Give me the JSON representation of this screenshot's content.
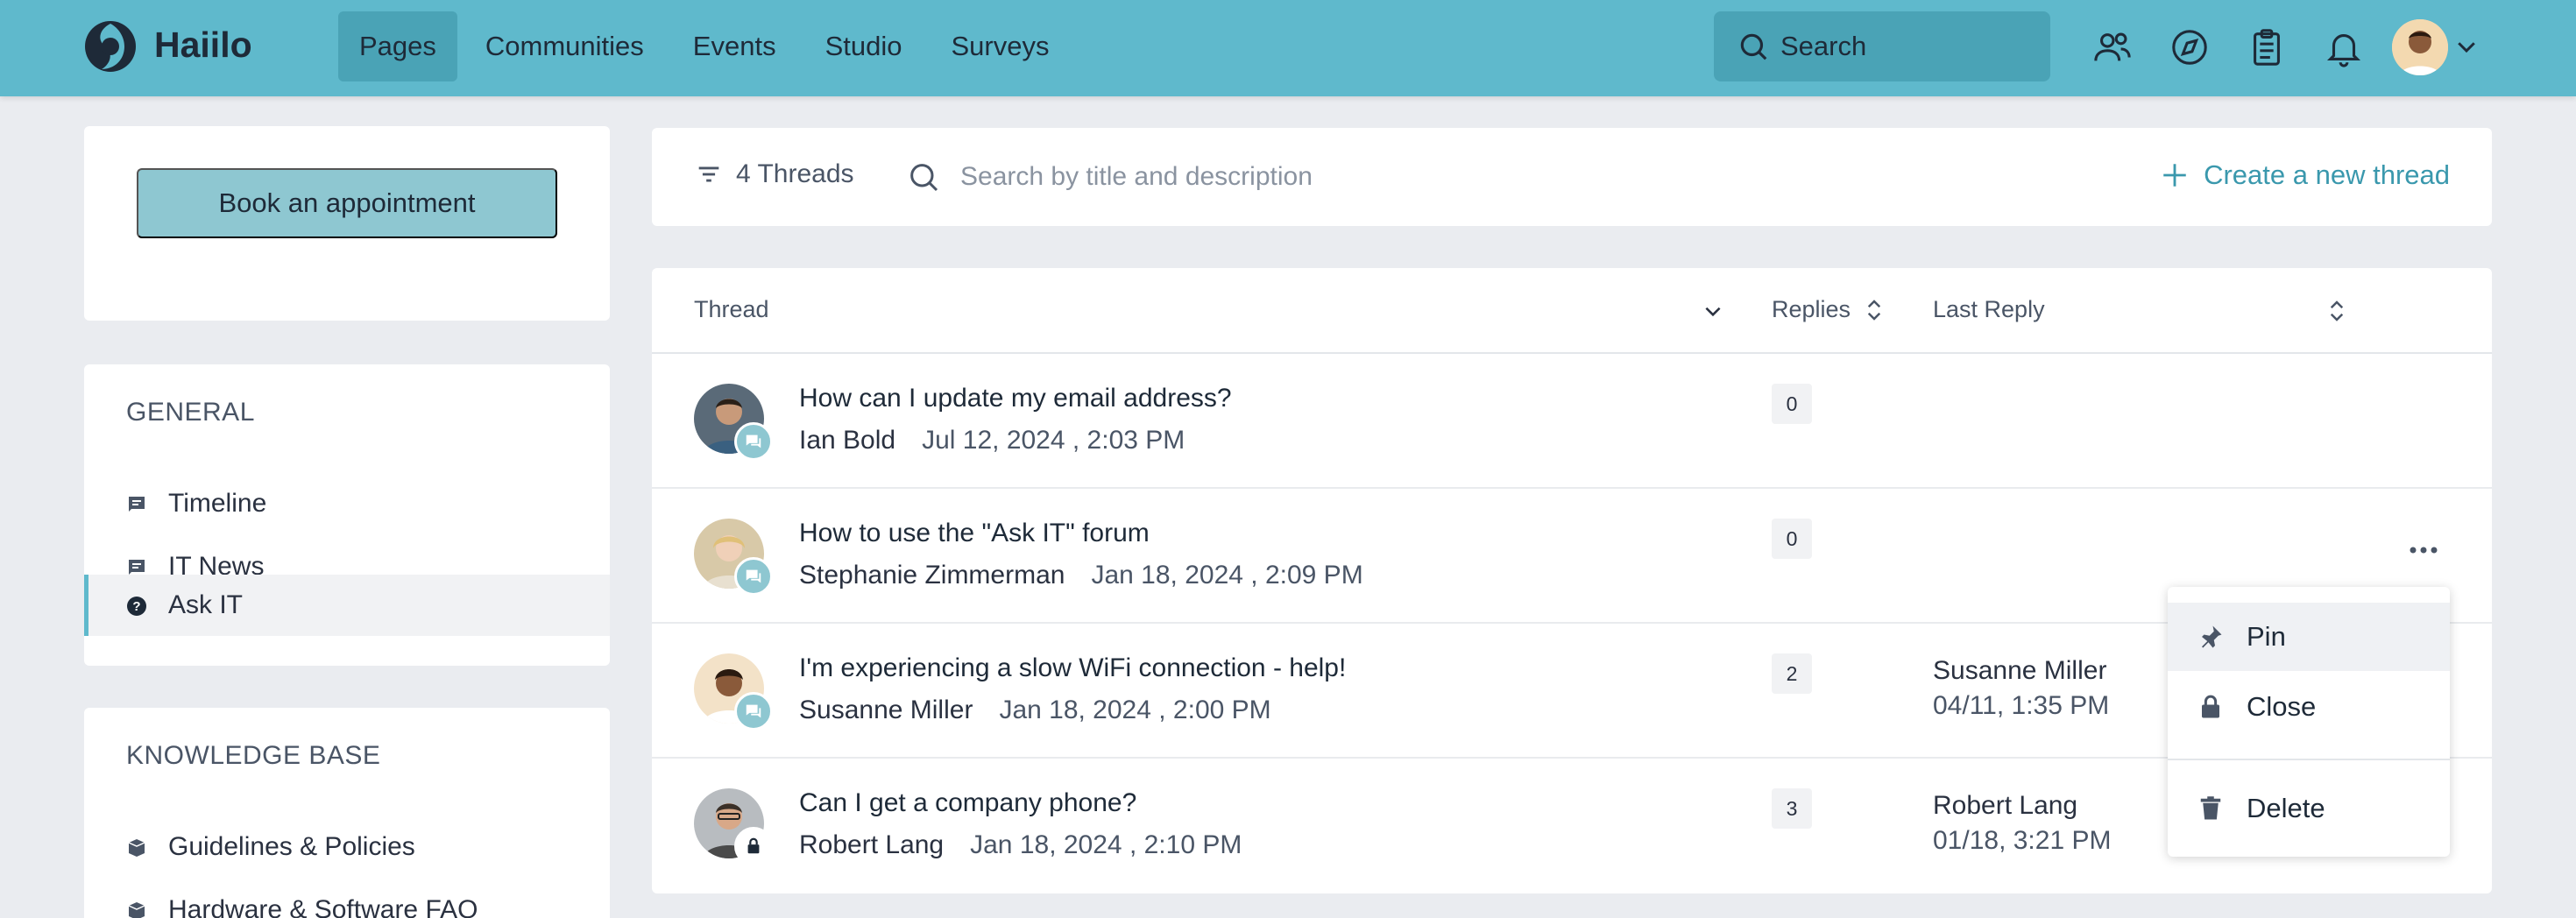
{
  "app": {
    "brand": "Haiilo",
    "accent": "#5fb9cc"
  },
  "nav": {
    "items": [
      "Pages",
      "Communities",
      "Events",
      "Studio",
      "Surveys"
    ],
    "active": "Pages"
  },
  "search": {
    "placeholder": "Search"
  },
  "header_icons": [
    "people-icon",
    "compass-icon",
    "clipboard-icon",
    "bell-icon",
    "avatar",
    "chevron-down-icon"
  ],
  "sidebar": {
    "book_button": "Book an appointment",
    "general": {
      "title": "GENERAL",
      "items": [
        "Timeline",
        "IT News",
        "Ask IT"
      ],
      "active": "Ask IT"
    },
    "knowledge": {
      "title": "KNOWLEDGE BASE",
      "items": [
        "Guidelines & Policies",
        "Hardware & Software FAQ"
      ]
    }
  },
  "toolbar": {
    "threads_count": "4 Threads",
    "search_placeholder": "Search by title and description",
    "create_label": "Create a new thread"
  },
  "table": {
    "headers": {
      "thread": "Thread",
      "replies": "Replies",
      "last_reply": "Last Reply"
    },
    "rows": [
      {
        "title": "How can I update my email address?",
        "author": "Ian Bold",
        "date": "Jul 12, 2024 , 2:03 PM",
        "replies": "0",
        "last_by": "",
        "last_date": ""
      },
      {
        "title": "How to use the \"Ask IT\" forum",
        "author": "Stephanie Zimmerman",
        "date": "Jan 18, 2024 , 2:09 PM",
        "replies": "0",
        "last_by": "",
        "last_date": ""
      },
      {
        "title": "I'm experiencing a slow WiFi connection - help!",
        "author": "Susanne Miller",
        "date": "Jan 18, 2024 , 2:00 PM",
        "replies": "2",
        "last_by": "Susanne Miller",
        "last_date": "04/11, 1:35 PM"
      },
      {
        "title": "Can I get a company phone?",
        "author": "Robert Lang",
        "date": "Jan 18, 2024 , 2:10 PM",
        "replies": "3",
        "last_by": "Robert Lang",
        "last_date": "01/18, 3:21 PM"
      }
    ]
  },
  "menu": {
    "pin": "Pin",
    "close": "Close",
    "delete": "Delete"
  }
}
